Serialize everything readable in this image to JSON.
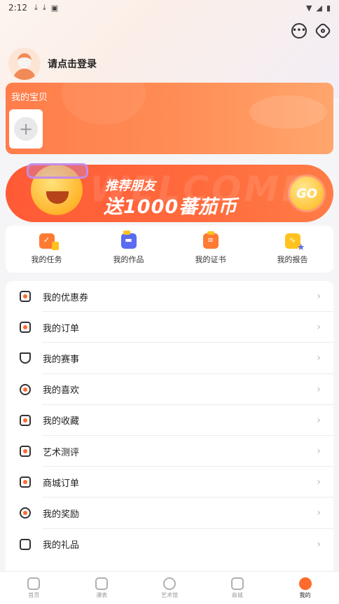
{
  "status_bar": {
    "time": "2:12",
    "icons": [
      "download-icon",
      "download-icon",
      "a-icon"
    ],
    "right_icons": [
      "wifi-icon",
      "signal-icon",
      "battery-icon"
    ]
  },
  "header": {
    "icons": [
      "message-icon",
      "settings-icon"
    ]
  },
  "profile": {
    "login_text": "请点击登录"
  },
  "baby_card": {
    "title": "我的宝贝",
    "add_label": "+"
  },
  "promo": {
    "line1": "推荐朋友",
    "line2": "送1000蕃茄币",
    "go_label": "GO",
    "watermark": "WELCOME"
  },
  "quick_actions": [
    {
      "label": "我的任务",
      "icon": "task-icon"
    },
    {
      "label": "我的作品",
      "icon": "works-icon"
    },
    {
      "label": "我的证书",
      "icon": "certificate-icon"
    },
    {
      "label": "我的报告",
      "icon": "report-icon"
    }
  ],
  "menu": [
    {
      "label": "我的优惠券",
      "icon": "coupon-icon"
    },
    {
      "label": "我的订单",
      "icon": "order-icon"
    },
    {
      "label": "我的赛事",
      "icon": "trophy-icon"
    },
    {
      "label": "我的喜欢",
      "icon": "heart-icon"
    },
    {
      "label": "我的收藏",
      "icon": "bookmark-icon"
    },
    {
      "label": "艺术测评",
      "icon": "assessment-icon"
    },
    {
      "label": "商城订单",
      "icon": "shop-order-icon"
    },
    {
      "label": "我的奖励",
      "icon": "reward-icon"
    },
    {
      "label": "我的礼品",
      "icon": "gift-icon"
    }
  ],
  "menu_chevron": "›",
  "tabs": [
    {
      "label": "首页",
      "icon": "home-icon",
      "active": false
    },
    {
      "label": "课表",
      "icon": "schedule-icon",
      "active": false
    },
    {
      "label": "艺术馆",
      "icon": "palette-icon",
      "active": false
    },
    {
      "label": "商城",
      "icon": "shop-icon",
      "active": false
    },
    {
      "label": "我的",
      "icon": "profile-icon",
      "active": true
    }
  ],
  "colors": {
    "accent": "#ff6a2d",
    "card_orange": "#ff7d4a",
    "promo_red": "#ff5a36",
    "go_yellow": "#ffc53d"
  }
}
